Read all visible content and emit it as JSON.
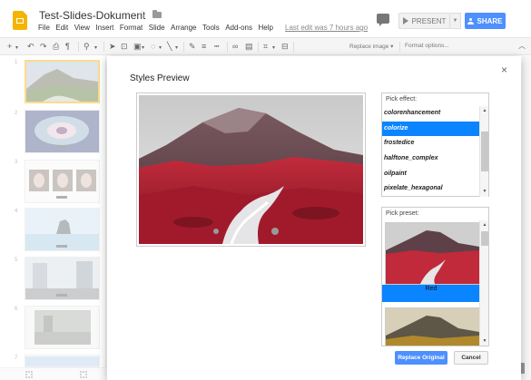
{
  "app": {
    "doc_title": "Test-Slides-Dokument",
    "last_edit": "Last edit was 7 hours ago"
  },
  "menu": [
    "File",
    "Edit",
    "View",
    "Insert",
    "Format",
    "Slide",
    "Arrange",
    "Tools",
    "Add-ons",
    "Help"
  ],
  "header": {
    "present_label": "PRESENT",
    "share_label": "SHARE"
  },
  "toolbar": {
    "replace_image": "Replace image ▾",
    "format_options": "Format options..."
  },
  "filmstrip": {
    "numbers": [
      "1",
      "2",
      "3",
      "4",
      "5",
      "6",
      "7"
    ]
  },
  "dialog": {
    "title": "Styles Preview",
    "close_glyph": "×",
    "pick_effect_label": "Pick effect:",
    "effects": [
      "colorenhancement",
      "colorize",
      "frostedice",
      "halftone_complex",
      "oilpaint",
      "pixelate_hexagonal"
    ],
    "selected_effect": "colorize",
    "pick_preset_label": "Pick preset:",
    "preset_selected_label": "Red",
    "replace_button": "Replace Original",
    "cancel_button": "Cancel"
  },
  "colors": {
    "accent_blue": "#4d90fe",
    "selection_blue": "#0a84ff",
    "slides_yellow": "#f4b400"
  },
  "icons": {
    "close": "close-icon",
    "star": "star-icon",
    "folder": "folder-icon",
    "comment": "comment-icon",
    "play": "play-icon"
  }
}
